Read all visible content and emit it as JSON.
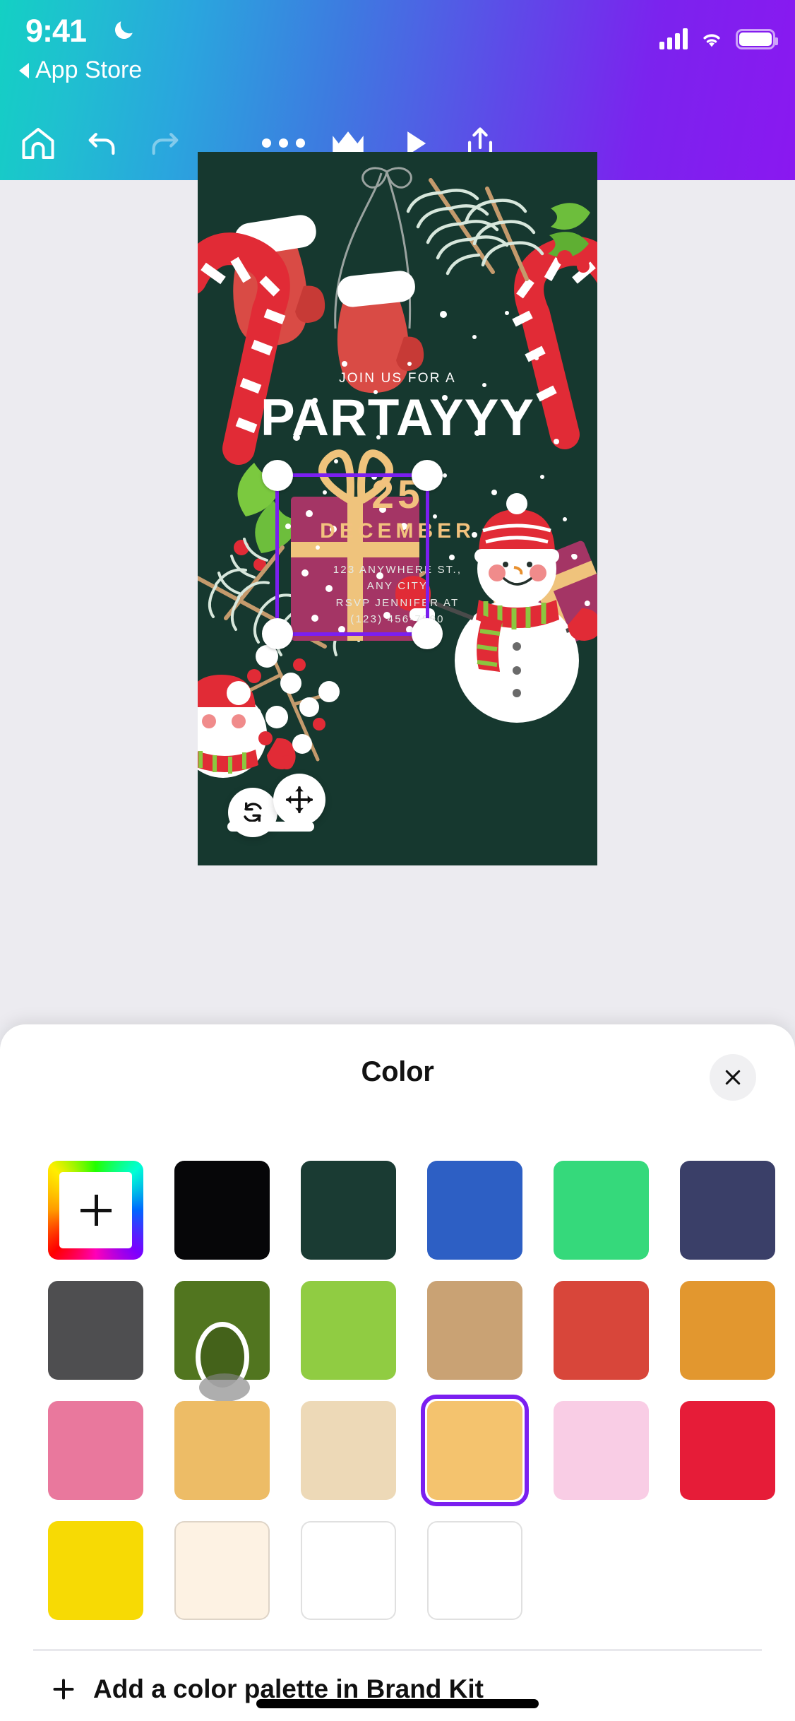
{
  "status_bar": {
    "time": "9:41",
    "moon_icon": "crescent-moon-icon",
    "back_label": "App Store",
    "signal_icon": "cellular-signal-icon",
    "wifi_icon": "wifi-icon",
    "battery_icon": "battery-full-icon"
  },
  "toolbar": {
    "home_label": "home-icon",
    "undo_label": "undo-icon",
    "redo_label": "redo-icon",
    "more_label": "more-options-icon",
    "crown_label": "crown-premium-icon",
    "play_label": "play-present-icon",
    "share_label": "share-export-icon"
  },
  "design": {
    "background_color": "#16382F",
    "join_text": "JOIN US FOR A",
    "title": "PARTAYYY",
    "day": "25",
    "month": "DECEMBER",
    "address_line1": "123 ANYWHERE ST.,",
    "address_line2": "ANY CITY",
    "address_line3": "RSVP JENNIFER AT",
    "address_line4": "(123) 456-7890",
    "title_color": "#FFFFFF",
    "date_color": "#F2C27E",
    "selection_color": "#7B1FF0"
  },
  "canvas_controls": {
    "rotate_label": "rotate-icon",
    "move_label": "move-icon"
  },
  "color_sheet": {
    "title": "Color",
    "close_label": "close-icon",
    "footer_text": "Add a color palette in Brand Kit",
    "footer_icon": "plus-icon",
    "swatches": [
      {
        "name": "custom-color-picker",
        "color": "rainbow",
        "type": "add",
        "selected": false
      },
      {
        "name": "black",
        "color": "#060608",
        "selected": false
      },
      {
        "name": "dark-green",
        "color": "#1A3B33",
        "selected": false
      },
      {
        "name": "blue",
        "color": "#2D5FC4",
        "selected": false
      },
      {
        "name": "emerald-green",
        "color": "#35D97B",
        "selected": false
      },
      {
        "name": "navy",
        "color": "#3A3F68",
        "selected": false
      },
      {
        "name": "dark-gray",
        "color": "#4E4E50",
        "selected": false
      },
      {
        "name": "olive-green",
        "color": "#51751F",
        "selected": false,
        "pressed": true
      },
      {
        "name": "light-green",
        "color": "#90CC42",
        "selected": false
      },
      {
        "name": "tan",
        "color": "#C9A274",
        "selected": false
      },
      {
        "name": "red",
        "color": "#D8463A",
        "selected": false
      },
      {
        "name": "orange",
        "color": "#E2972F",
        "selected": false
      },
      {
        "name": "pink",
        "color": "#E9789D",
        "selected": false
      },
      {
        "name": "light-orange",
        "color": "#EDBC66",
        "selected": false
      },
      {
        "name": "beige",
        "color": "#EDD9B7",
        "selected": false
      },
      {
        "name": "selected-peach",
        "color": "#F4C36E",
        "selected": true
      },
      {
        "name": "light-pink",
        "color": "#F9CDE5",
        "selected": false
      },
      {
        "name": "crimson",
        "color": "#E61C38",
        "selected": false
      },
      {
        "name": "yellow",
        "color": "#F7DA04",
        "selected": false
      },
      {
        "name": "cream",
        "color": "#FDF2E3",
        "selected": false
      },
      {
        "name": "white",
        "color": "#FFFFFF",
        "selected": false
      },
      {
        "name": "white-2",
        "color": "#FFFFFF",
        "selected": false
      }
    ]
  }
}
